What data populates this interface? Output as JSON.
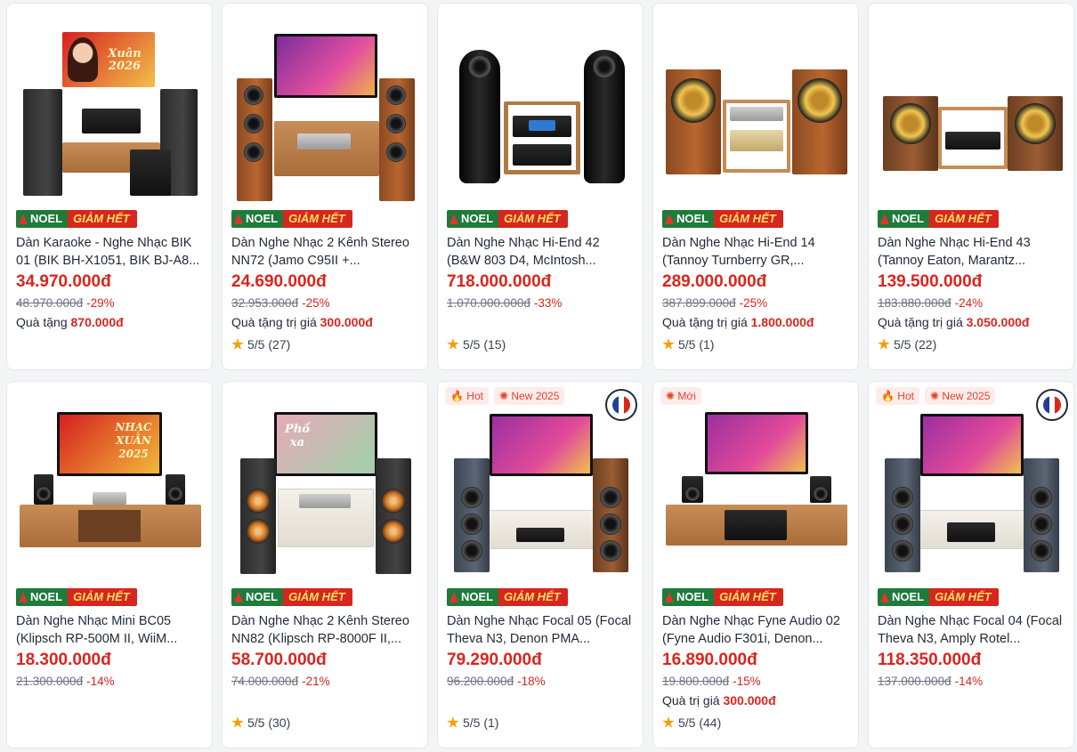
{
  "badge": {
    "left": "NOEL",
    "right": "GIẢM HẾT"
  },
  "rating_prefix_star": "star-icon",
  "products": [
    {
      "title": "Dàn Karaoke - Nghe Nhạc BIK 01 (BIK BH-X1051, BIK BJ-A8...",
      "price": "34.970.000đ",
      "old_price": "48.970.000đ",
      "discount": "-29%",
      "gift_label": "Quà tặng",
      "gift_value": "870.000đ",
      "rating": "",
      "tv_text": "Xuân 2026"
    },
    {
      "title": "Dàn Nghe Nhạc 2 Kênh Stereo NN72 (Jamo C95II +...",
      "price": "24.690.000đ",
      "old_price": "32.953.000đ",
      "discount": "-25%",
      "gift_label": "Quà tặng trị giá",
      "gift_value": "300.000đ",
      "rating": "5/5 (27)"
    },
    {
      "title": "Dàn Nghe Nhạc Hi-End 42 (B&W 803 D4, McIntosh...",
      "price": "718.000.000đ",
      "old_price": "1.070.000.000đ",
      "discount": "-33%",
      "gift_label": "",
      "gift_value": "",
      "rating": "5/5 (15)"
    },
    {
      "title": "Dàn Nghe Nhạc Hi-End 14 (Tannoy Turnberry GR,...",
      "price": "289.000.000đ",
      "old_price": "387.899.000đ",
      "discount": "-25%",
      "gift_label": "Quà tặng trị giá",
      "gift_value": "1.800.000đ",
      "rating": "5/5 (1)"
    },
    {
      "title": "Dàn Nghe Nhạc Hi-End 43 (Tannoy Eaton, Marantz...",
      "price": "139.500.000đ",
      "old_price": "183.880.000đ",
      "discount": "-24%",
      "gift_label": "Quà tặng trị giá",
      "gift_value": "3.050.000đ",
      "rating": "5/5 (22)"
    },
    {
      "title": "Dàn Nghe Nhạc Mini BC05 (Klipsch RP-500M II, WiiM...",
      "price": "18.300.000đ",
      "old_price": "21.300.000đ",
      "discount": "-14%",
      "gift_label": "",
      "gift_value": "",
      "rating": "",
      "tv_text": "NHẠC XUÂN 2025"
    },
    {
      "title": "Dàn Nghe Nhạc 2 Kênh Stereo NN82 (Klipsch RP-8000F II,...",
      "price": "58.700.000đ",
      "old_price": "74.000.000đ",
      "discount": "-21%",
      "gift_label": "",
      "gift_value": "",
      "rating": "5/5 (30)",
      "tv_text": "Phố xa"
    },
    {
      "title": "Dàn Nghe Nhạc Focal 05 (Focal Theva N3, Denon PMA...",
      "price": "79.290.000đ",
      "old_price": "96.200.000đ",
      "discount": "-18%",
      "gift_label": "",
      "gift_value": "",
      "rating": "5/5 (1)",
      "tags": [
        "Hot",
        "New 2025"
      ]
    },
    {
      "title": "Dàn Nghe Nhạc Fyne Audio 02 (Fyne Audio F301i, Denon...",
      "price": "16.890.000đ",
      "old_price": "19.800.000đ",
      "discount": "-15%",
      "gift_label": "Quà trị giá",
      "gift_value": "300.000đ",
      "rating": "5/5 (44)",
      "tags": [
        "Mới"
      ]
    },
    {
      "title": "Dàn Nghe Nhạc Focal 04 (Focal Theva N3, Amply Rotel...",
      "price": "118.350.000đ",
      "old_price": "137.000.000đ",
      "discount": "-14%",
      "gift_label": "",
      "gift_value": "",
      "rating": "",
      "tags": [
        "Hot",
        "New 2025"
      ]
    }
  ]
}
